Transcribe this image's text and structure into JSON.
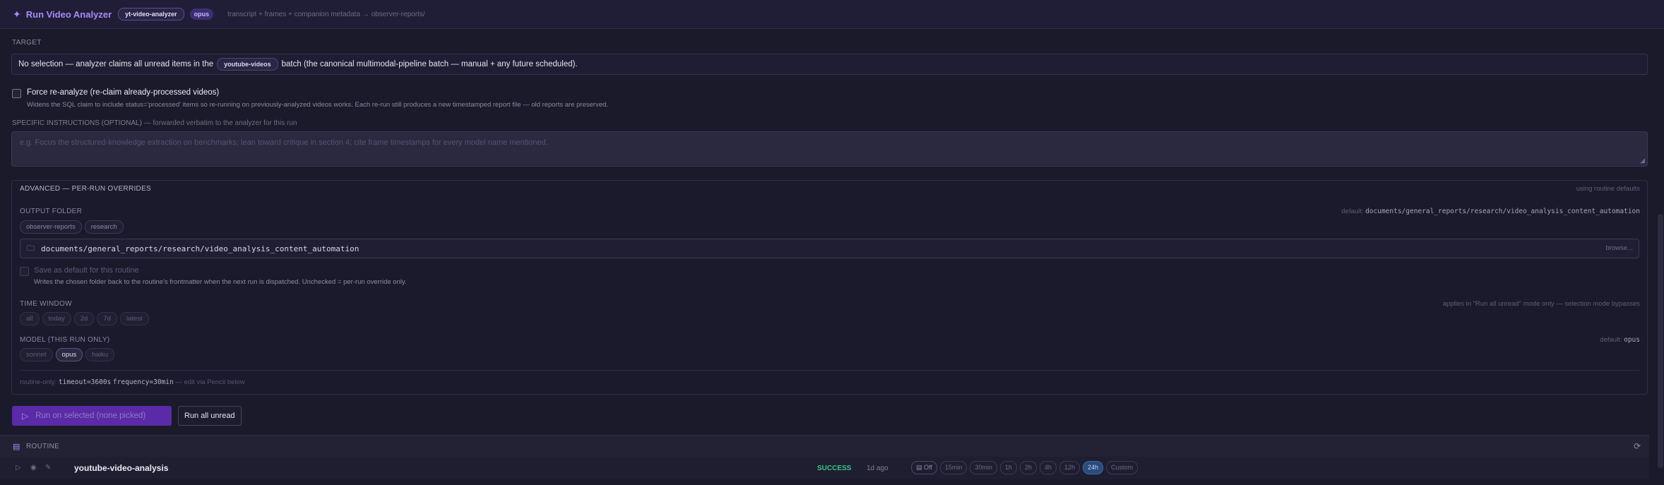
{
  "header": {
    "title": "Run Video Analyzer",
    "agent_tag": "yt-video-analyzer",
    "model_tag": "opus",
    "description": "transcript + frames + companion metadata → observer-reports/"
  },
  "target": {
    "label": "TARGET",
    "text_before": "No selection — analyzer claims all unread items in the",
    "batch_pill": "youtube-videos",
    "text_after": "batch (the canonical multimodal-pipeline batch — manual + any future scheduled)."
  },
  "force": {
    "label": "Force re-analyze (re-claim already-processed videos)",
    "help": "Widens the SQL claim to include status='processed' items so re-running on previously-analyzed videos works. Each re-run still produces a new timestamped report file — old reports are preserved."
  },
  "instructions": {
    "label": "SPECIFIC INSTRUCTIONS (OPTIONAL)",
    "sublabel": "— forwarded verbatim to the analyzer for this run",
    "placeholder": "e.g. Focus the structured-knowledge extraction on benchmarks; lean toward critique in section 4; cite frame timestamps for every model name mentioned."
  },
  "advanced": {
    "title": "ADVANCED — PER-RUN OVERRIDES",
    "right_note": "using routine defaults",
    "output_folder": {
      "label": "OUTPUT FOLDER",
      "default_prefix": "default:",
      "default_value": "documents/general_reports/research/video_analysis_content_automation",
      "chips": [
        "observer-reports",
        "research"
      ],
      "value": "documents/general_reports/research/video_analysis_content_automation",
      "browse": "browse..."
    },
    "save_default": {
      "label": "Save as default for this routine",
      "help": "Writes the chosen folder back to the routine's frontmatter when the next run is dispatched. Unchecked = per-run override only."
    },
    "time_window": {
      "label": "TIME WINDOW",
      "note": "applies in \"Run all unread\" mode only — selection mode bypasses",
      "options": [
        "all",
        "today",
        "2d",
        "7d",
        "latest"
      ]
    },
    "model": {
      "label": "MODEL (THIS RUN ONLY)",
      "default_prefix": "default:",
      "default_value": "opus",
      "options": [
        "sonnet",
        "opus",
        "haiku"
      ],
      "selected": "opus"
    },
    "routine_only": {
      "prefix": "routine-only:",
      "timeout": "timeout=3600s",
      "frequency": "frequency=30min",
      "suffix": "— edit via Pencil below"
    }
  },
  "buttons": {
    "run_selected": "Run on selected (none picked)",
    "run_all": "Run all unread"
  },
  "routine": {
    "section_label": "ROUTINE",
    "name": "youtube-video-analysis",
    "status": "SUCCESS",
    "last_run": "1d ago",
    "frequency_options": [
      "Off",
      "15min",
      "30min",
      "1h",
      "2h",
      "4h",
      "12h",
      "24h",
      "Custom"
    ],
    "frequency_selected": "24h"
  },
  "colors": {
    "accent": "#a78bfa",
    "primary_button": "#5b2aa8",
    "success": "#34c58a",
    "active_frequency": "#2b4c7a"
  }
}
